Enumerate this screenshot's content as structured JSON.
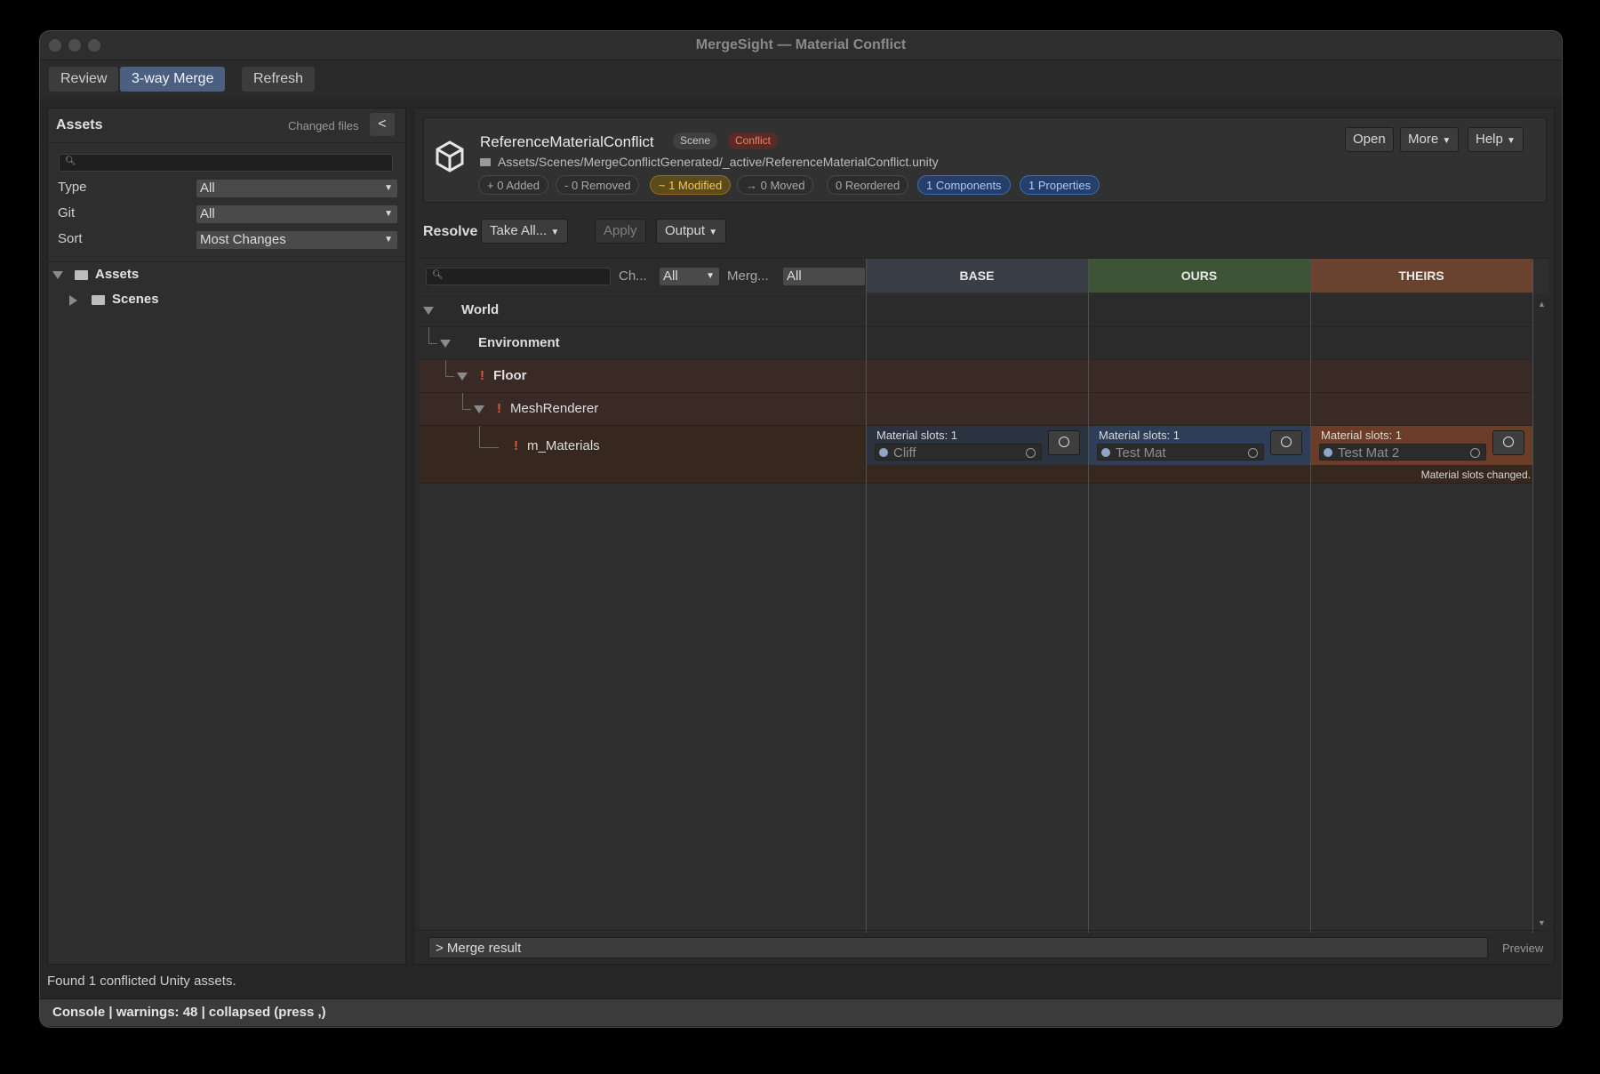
{
  "window": {
    "title": "MergeSight — Material Conflict"
  },
  "toolbar": {
    "tabs": [
      {
        "label": "Review"
      },
      {
        "label": "3-way Merge"
      },
      {
        "label": "Refresh"
      }
    ]
  },
  "left": {
    "title": "Assets",
    "changed_files": "Changed files",
    "collapse": "<",
    "search_placeholder": "",
    "filters": [
      {
        "label": "Type",
        "value": "All"
      },
      {
        "label": "Git",
        "value": "All"
      },
      {
        "label": "Sort",
        "value": "Most Changes"
      }
    ],
    "tree": [
      {
        "label": "Assets"
      },
      {
        "label": "Scenes"
      }
    ]
  },
  "asset": {
    "name": "ReferenceMaterialConflict",
    "badges": [
      "Scene",
      "Conflict"
    ],
    "path": "Assets/Scenes/MergeConflictGenerated/_active/ReferenceMaterialConflict.unity",
    "stats": [
      "+ 0 Added",
      "- 0 Removed",
      "~ 1 Modified",
      "→ 0 Moved",
      "0 Reordered",
      "1 Components",
      "1 Properties"
    ],
    "buttons": [
      "Open",
      "More",
      "Help"
    ]
  },
  "resolve": {
    "label": "Resolve",
    "take_all": "Take All...",
    "apply": "Apply",
    "output": "Output"
  },
  "grid": {
    "filter_change_label": "Ch...",
    "filter_change_value": "All",
    "filter_merge_label": "Merg...",
    "filter_merge_value": "All",
    "columns": [
      "BASE",
      "OURS",
      "THEIRS"
    ],
    "rows": [
      {
        "label": "World"
      },
      {
        "label": "Environment"
      },
      {
        "label": "Floor"
      },
      {
        "label": "MeshRenderer"
      },
      {
        "label": "m_Materials"
      }
    ],
    "cells": {
      "base": {
        "slots": "Material slots: 1",
        "value": "Cliff"
      },
      "ours": {
        "slots": "Material slots: 1",
        "value": "Test Mat"
      },
      "theirs": {
        "slots": "Material slots: 1",
        "value": "Test Mat 2",
        "note": "Material slots changed."
      }
    }
  },
  "merge_result": {
    "label": "> Merge result",
    "preview": "Preview"
  },
  "status": "Found 1 conflicted Unity assets.",
  "console": "Console | warnings: 48 | collapsed (press ,)",
  "colors": {
    "base_header": "#3a3e46",
    "ours_header": "#3d5536",
    "theirs_header": "#6a4230",
    "conflict_row": "#3a2a26",
    "active_tab": "#4b5f80"
  }
}
